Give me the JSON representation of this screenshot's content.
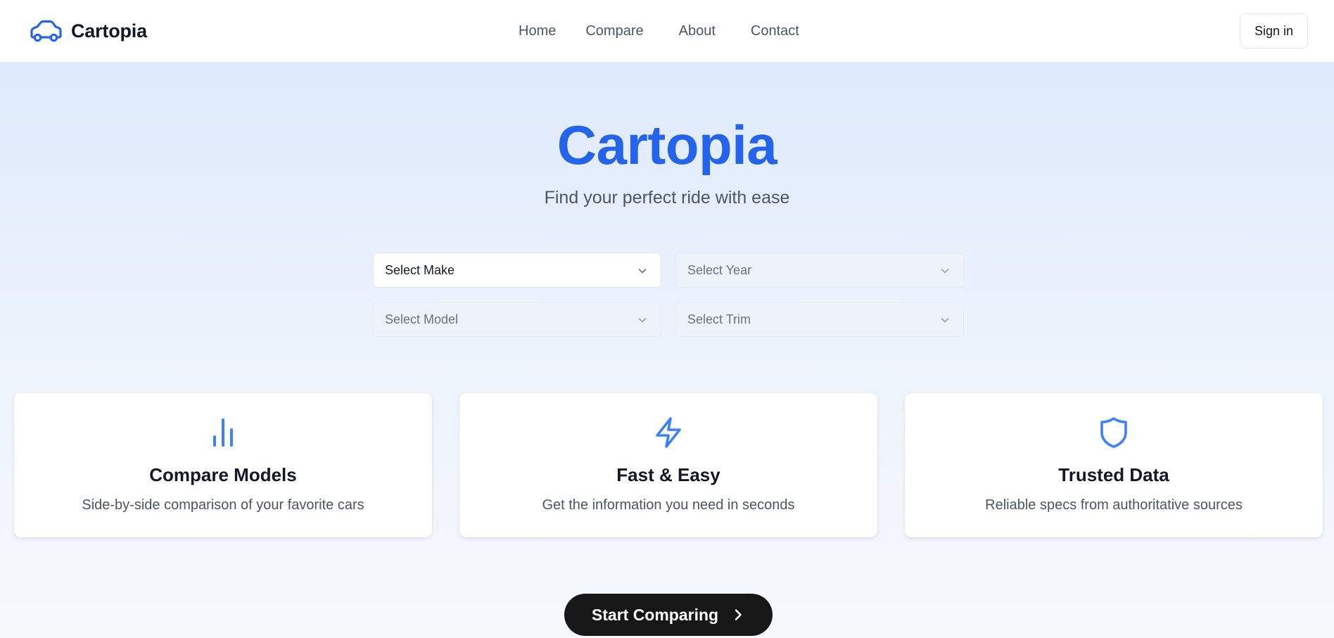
{
  "brand": {
    "name": "Cartopia",
    "icon": "car-icon",
    "accent": "#2563eb"
  },
  "nav": {
    "items": [
      {
        "label": "Home"
      },
      {
        "label": "Compare"
      },
      {
        "label": "About"
      },
      {
        "label": "Contact"
      }
    ]
  },
  "auth": {
    "signin_label": "Sign in"
  },
  "hero": {
    "title": "Cartopia",
    "subtitle": "Find your perfect ride with ease"
  },
  "selects": {
    "make": {
      "value": "Select Make",
      "enabled": true
    },
    "year": {
      "value": "Select Year",
      "enabled": false
    },
    "model": {
      "value": "Select Model",
      "enabled": false
    },
    "trim": {
      "value": "Select Trim",
      "enabled": false
    }
  },
  "features": [
    {
      "icon": "bar-chart-icon",
      "title": "Compare Models",
      "description": "Side-by-side comparison of your favorite cars"
    },
    {
      "icon": "lightning-bolt-icon",
      "title": "Fast & Easy",
      "description": "Get the information you need in seconds"
    },
    {
      "icon": "shield-icon",
      "title": "Trusted Data",
      "description": "Reliable specs from authoritative sources"
    }
  ],
  "cta": {
    "label": "Start Comparing",
    "icon": "chevron-right-icon"
  },
  "colors": {
    "accent": "#2563eb",
    "cta_bg": "#171717",
    "text_muted": "#4b5563"
  }
}
